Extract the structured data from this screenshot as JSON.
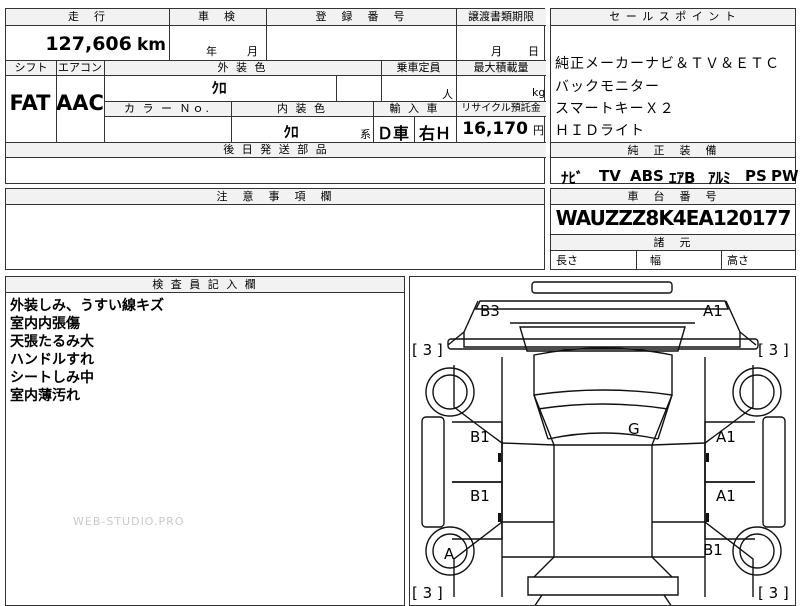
{
  "top": {
    "headers": {
      "mileage": "走　行",
      "inspection": "車　検",
      "registration": "登　録　番　号",
      "transfer": "譲渡書類期限"
    },
    "mileage_value": "127,606",
    "mileage_unit": "km",
    "inspection_year_unit": "年",
    "inspection_month_unit": "月",
    "transfer_month_unit": "月",
    "transfer_day_unit": "日",
    "row2_headers": {
      "shift": "シフト",
      "aircon": "エアコン",
      "exterior": "外 装 色",
      "capacity": "乗車定員",
      "max_load": "最大積載量"
    },
    "shift_value": "FAT",
    "aircon_value": "AAC",
    "exterior_color": "ｸﾛ",
    "capacity_unit": "人",
    "load_unit": "kg",
    "row3_headers": {
      "color_no": "カ ラ ー Ｎｏ.",
      "interior": "内 装 色",
      "import": "輸 入 車",
      "recycle": "リサイクル預託金"
    },
    "interior_color": "ｸﾛ",
    "interior_unit": "系",
    "import_type": "Ｄ車",
    "steering": "右Ｈ",
    "recycle_value": "16,170",
    "recycle_unit": "円",
    "later_parts": "後 日 発 送 部 品"
  },
  "sales_points": {
    "header": "セ ー ル ス ポ イ ン ト",
    "lines": [
      "純正メーカーナビ＆ＴＶ＆ＥＴＣ",
      "バックモニター",
      "スマートキーＸ２",
      "ＨＩＤライト"
    ]
  },
  "equipment": {
    "header": "純　正　装　備",
    "items": [
      "ﾅﾋﾞ",
      "TV",
      "ABS",
      "ｴｱB",
      "ｱﾙﾐ",
      "PS",
      "PW"
    ]
  },
  "notes": {
    "header": "注　意　事　項　欄"
  },
  "chassis": {
    "header": "車　台　番　号",
    "number": "WAUZZZ8K4EA120177",
    "dimensions_header": "諸　元",
    "length_label": "長さ",
    "width_label": "幅",
    "height_label": "高さ"
  },
  "inspector": {
    "header": "検 査 員 記 入 欄",
    "lines": [
      "外装しみ、うすい線キズ",
      "室内内張傷",
      "天張たるみ大",
      "ハンドルすれ",
      "シートしみ中",
      "室内薄汚れ"
    ]
  },
  "watermark": "WEB-STUDIO.PRO",
  "diagram": {
    "labels": {
      "b3": "B3",
      "a1_top": "A1",
      "g": "G",
      "b1_left_upper": "B1",
      "a1_right_upper": "A1",
      "b1_left_lower": "B1",
      "a1_right_lower": "A1",
      "a_tire": "A",
      "b1_tire": "B1"
    },
    "tire_depth": [
      "[ 3 ]",
      "[ 3 ]",
      "[ 3 ]",
      "[ 3 ]"
    ]
  }
}
